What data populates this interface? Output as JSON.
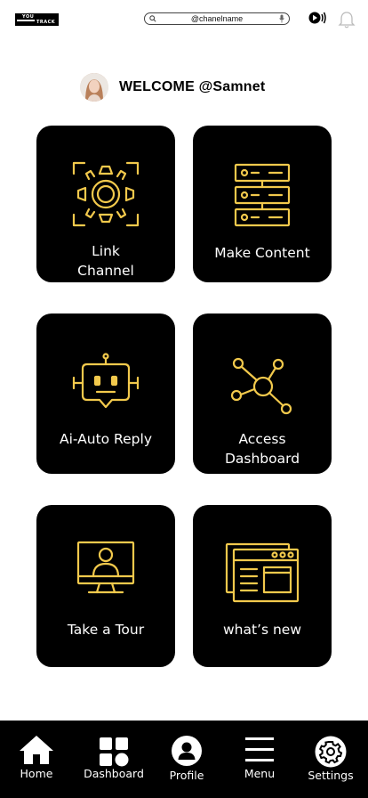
{
  "header": {
    "logo_top": "YOU",
    "logo_bottom": "TRACK",
    "search_placeholder": "@chanelname"
  },
  "welcome": {
    "text": "WELCOME @Samnet"
  },
  "tiles": [
    {
      "label_line1": "Link",
      "label_line2": "Channel",
      "icon": "target-icon"
    },
    {
      "label_line1": "Make Content",
      "label_line2": "",
      "icon": "server-icon"
    },
    {
      "label_line1": "Ai-Auto Reply",
      "label_line2": "",
      "icon": "robot-icon"
    },
    {
      "label_line1": "Access",
      "label_line2": "Dashboard",
      "icon": "network-icon"
    },
    {
      "label_line1": "Take a Tour",
      "label_line2": "",
      "icon": "monitor-user-icon"
    },
    {
      "label_line1": "what’s new",
      "label_line2": "",
      "icon": "browser-windows-icon"
    }
  ],
  "nav": [
    {
      "label": "Home",
      "icon": "home-icon"
    },
    {
      "label": "Dashboard",
      "icon": "dashboard-icon"
    },
    {
      "label": "Profile",
      "icon": "profile-icon"
    },
    {
      "label": "Menu",
      "icon": "menu-icon"
    },
    {
      "label": "Settings",
      "icon": "gear-icon"
    }
  ],
  "colors": {
    "accent": "#f2c94c",
    "tile_bg": "#000000",
    "nav_bg": "#000000"
  }
}
